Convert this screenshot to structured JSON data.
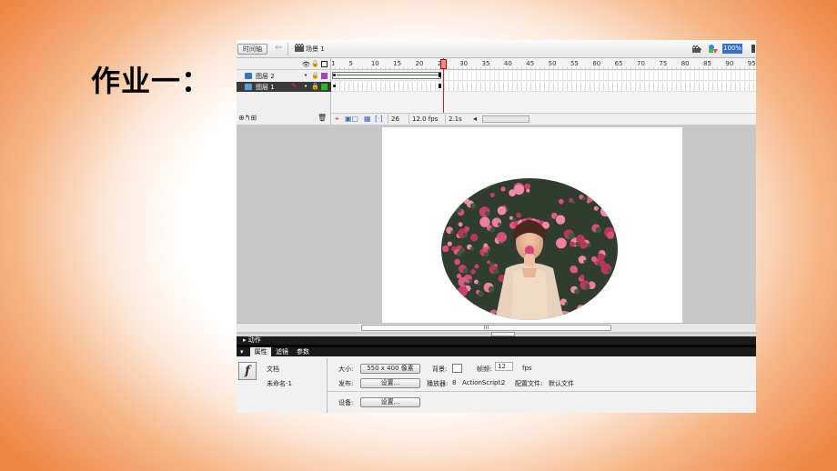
{
  "slide": {
    "title": "作业一："
  },
  "toolbar": {
    "timeline_tab": "时间轴",
    "scene_label": "场景 1",
    "zoom": "100%"
  },
  "timeline": {
    "ruler_ticks": [
      "1",
      "5",
      "10",
      "15",
      "20",
      "25",
      "30",
      "35",
      "40",
      "45",
      "50",
      "55",
      "60",
      "65",
      "70",
      "75",
      "80",
      "85",
      "90",
      "95"
    ],
    "layers": [
      {
        "name": "图层 2",
        "color": "#a040c8",
        "selected": false
      },
      {
        "name": "图层 1",
        "color": "#22bb22",
        "selected": true
      }
    ],
    "current_frame": "26",
    "fps": "12.0 fps",
    "elapsed": "2.1s"
  },
  "stage": {
    "scroll_thumb": "III"
  },
  "panels": {
    "actions_label": "动作",
    "tab_properties": "属性",
    "tab_filters": "滤镜",
    "tab_params": "参数",
    "doc_label": "文档",
    "doc_name": "未命名-1",
    "size_label": "大小:",
    "size_value": "550 x 400 像素",
    "bg_label": "背景:",
    "framerate_label": "帧频:",
    "framerate_value": "12",
    "fps_unit": "fps",
    "publish_label": "发布:",
    "settings_btn": "设置...",
    "player_label": "播放器:",
    "player_value": "8",
    "as_label": "ActionScript:",
    "as_value": "2",
    "profile_label": "配置文件:",
    "profile_value": "默认文件",
    "device_label": "设备:",
    "device_btn": "设置..."
  },
  "icons": [
    "back-arrow-icon",
    "scene-icon",
    "edit-scene-icon",
    "edit-symbol-icon",
    "eye-icon",
    "lock-icon",
    "outline-icon",
    "layer-icon",
    "pencil-icon",
    "add-layer-icon",
    "trash-icon",
    "onion-skin-icon",
    "flash-logo-icon"
  ]
}
